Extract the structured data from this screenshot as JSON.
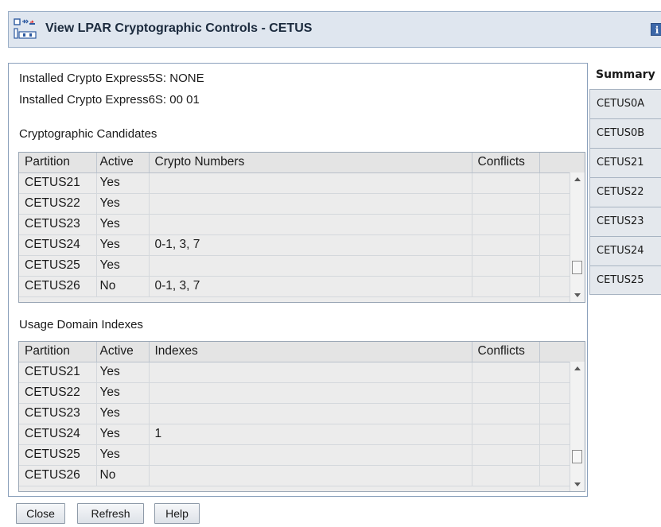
{
  "window": {
    "title": "View LPAR Cryptographic Controls - CETUS",
    "info_glyph": "i"
  },
  "installed": {
    "express5s": "Installed Crypto Express5S: NONE",
    "express6s": "Installed Crypto Express6S: 00 01"
  },
  "candidates": {
    "section_label": "Cryptographic Candidates",
    "columns": [
      "Partition",
      "Active",
      "Crypto Numbers",
      "Conflicts",
      ""
    ],
    "rows": [
      [
        "CETUS21",
        "Yes",
        "",
        ""
      ],
      [
        "CETUS22",
        "Yes",
        "",
        ""
      ],
      [
        "CETUS23",
        "Yes",
        "",
        ""
      ],
      [
        "CETUS24",
        "Yes",
        "0-1, 3, 7",
        ""
      ],
      [
        "CETUS25",
        "Yes",
        "",
        ""
      ],
      [
        "CETUS26",
        "No",
        "0-1, 3, 7",
        ""
      ]
    ],
    "scroll_position": 0.82
  },
  "usage": {
    "section_label": "Usage Domain Indexes",
    "columns": [
      "Partition",
      "Active",
      "Indexes",
      "Conflicts",
      ""
    ],
    "rows": [
      [
        "CETUS21",
        "Yes",
        "",
        ""
      ],
      [
        "CETUS22",
        "Yes",
        "",
        ""
      ],
      [
        "CETUS23",
        "Yes",
        "",
        ""
      ],
      [
        "CETUS24",
        "Yes",
        "1",
        ""
      ],
      [
        "CETUS25",
        "Yes",
        "",
        ""
      ],
      [
        "CETUS26",
        "No",
        "",
        ""
      ]
    ],
    "scroll_position": 0.82
  },
  "buttons": {
    "close": "Close",
    "refresh": "Refresh",
    "help": "Help"
  },
  "summary": {
    "title": "Summary",
    "tabs": [
      "CETUS0A",
      "CETUS0B",
      "CETUS21",
      "CETUS22",
      "CETUS23",
      "CETUS24",
      "CETUS25"
    ]
  },
  "colors": {
    "title_bar": "#dfe6ef",
    "grid_background": "#ececec",
    "info_icon": "#3c67a8"
  }
}
